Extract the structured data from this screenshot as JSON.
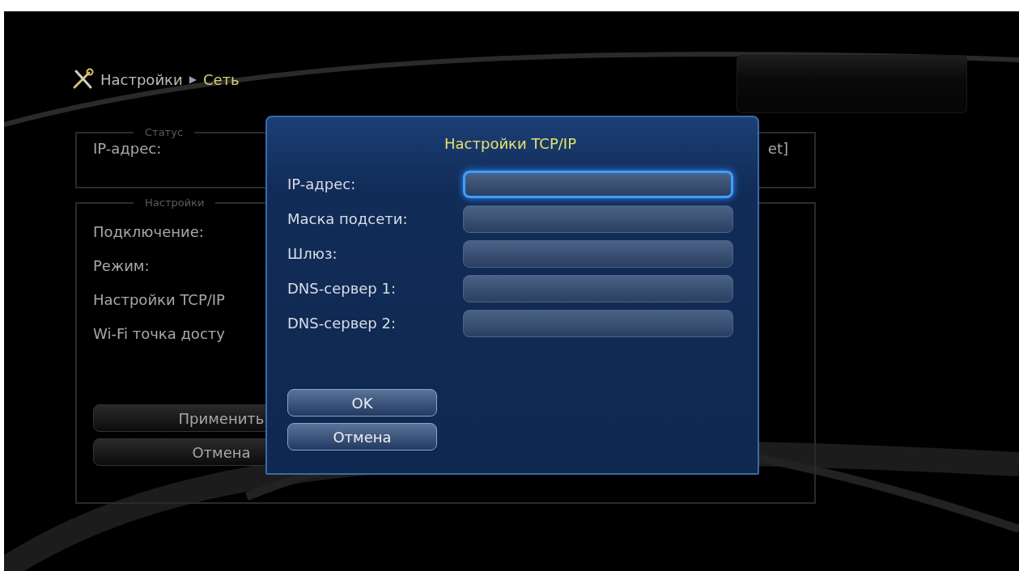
{
  "breadcrumb": {
    "root": "Настройки",
    "separator": "▶",
    "current": "Сеть"
  },
  "status": {
    "legend": "Статус",
    "label": "IP-адрес:",
    "value": "et]"
  },
  "settings": {
    "legend": "Настройки",
    "items": [
      "Подключение:",
      "Режим:",
      "Настройки TCP/IP",
      "Wi-Fi точка досту"
    ],
    "buttons": [
      "Применить",
      "Отмена"
    ]
  },
  "dialog": {
    "title": "Настройки TCP/IP",
    "fields": [
      {
        "label": "IP-адрес:",
        "focused": true
      },
      {
        "label": "Маска подсети:",
        "focused": false
      },
      {
        "label": "Шлюз:",
        "focused": false
      },
      {
        "label": "DNS-сервер 1:",
        "focused": false
      },
      {
        "label": "DNS-сервер 2:",
        "focused": false
      }
    ],
    "buttons": [
      "OK",
      "Отмена"
    ]
  }
}
